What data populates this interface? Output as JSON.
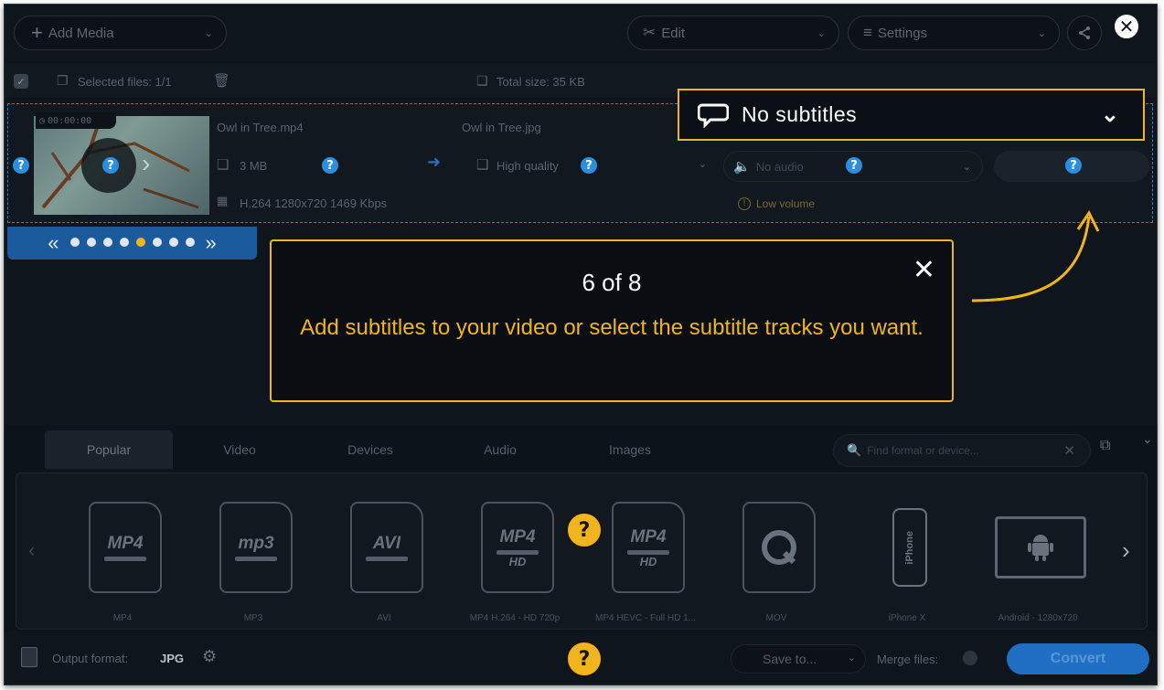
{
  "toolbar": {
    "add_media_label": "Add Media",
    "edit_label": "Edit",
    "settings_label": "Settings"
  },
  "file_bar": {
    "selected_files": "Selected files: 1/1",
    "total_size": "Total size: 35 KB"
  },
  "file_item": {
    "duration": "00:00:00",
    "source_name": "Owl in Tree.mp4",
    "output_name": "Owl in Tree.jpg",
    "size": "3 MB",
    "codec_info": "H.264 1280x720 1469 Kbps",
    "quality": "High quality",
    "audio": "No audio",
    "volume_warning": "Low volume",
    "subtitles": "No subtitles"
  },
  "tour": {
    "step_counter": "6 of 8",
    "message": "Add subtitles to your video or select the subtitle tracks you want.",
    "current_step": 4,
    "total_dots": 8
  },
  "format_tabs": [
    "Popular",
    "Video",
    "Devices",
    "Audio",
    "Images"
  ],
  "search": {
    "placeholder": "Find format or device..."
  },
  "formats": [
    {
      "caption": "MP4",
      "badge": "MP4",
      "icon": "mp4-file-icon"
    },
    {
      "caption": "MP3",
      "badge": "mp3",
      "icon": "mp3-file-icon"
    },
    {
      "caption": "AVI",
      "badge": "AVI",
      "icon": "avi-file-icon"
    },
    {
      "caption": "MP4 H.264 - HD 720p",
      "badge": "MP4",
      "sub": "HD",
      "icon": "mp4-hd-file-icon"
    },
    {
      "caption": "MP4 HEVC - Full HD 1...",
      "badge": "MP4",
      "sub": "HD",
      "icon": "mp4-hevc-file-icon"
    },
    {
      "caption": "MOV",
      "badge": "",
      "icon": "quicktime-icon"
    },
    {
      "caption": "iPhone X",
      "badge": "iPhone",
      "icon": "iphone-icon"
    },
    {
      "caption": "Android - 1280x720",
      "badge": "",
      "icon": "android-icon"
    }
  ],
  "bottom_bar": {
    "output_label": "Output format:",
    "output_value": "JPG",
    "save_to": "Save to...",
    "merge_files": "Merge files:",
    "convert": "Convert"
  },
  "colors": {
    "accent_gold": "#f0b41e",
    "help_blue": "#2b8fe0",
    "convert_blue": "#1f6fc4",
    "background": "#0f151c"
  }
}
